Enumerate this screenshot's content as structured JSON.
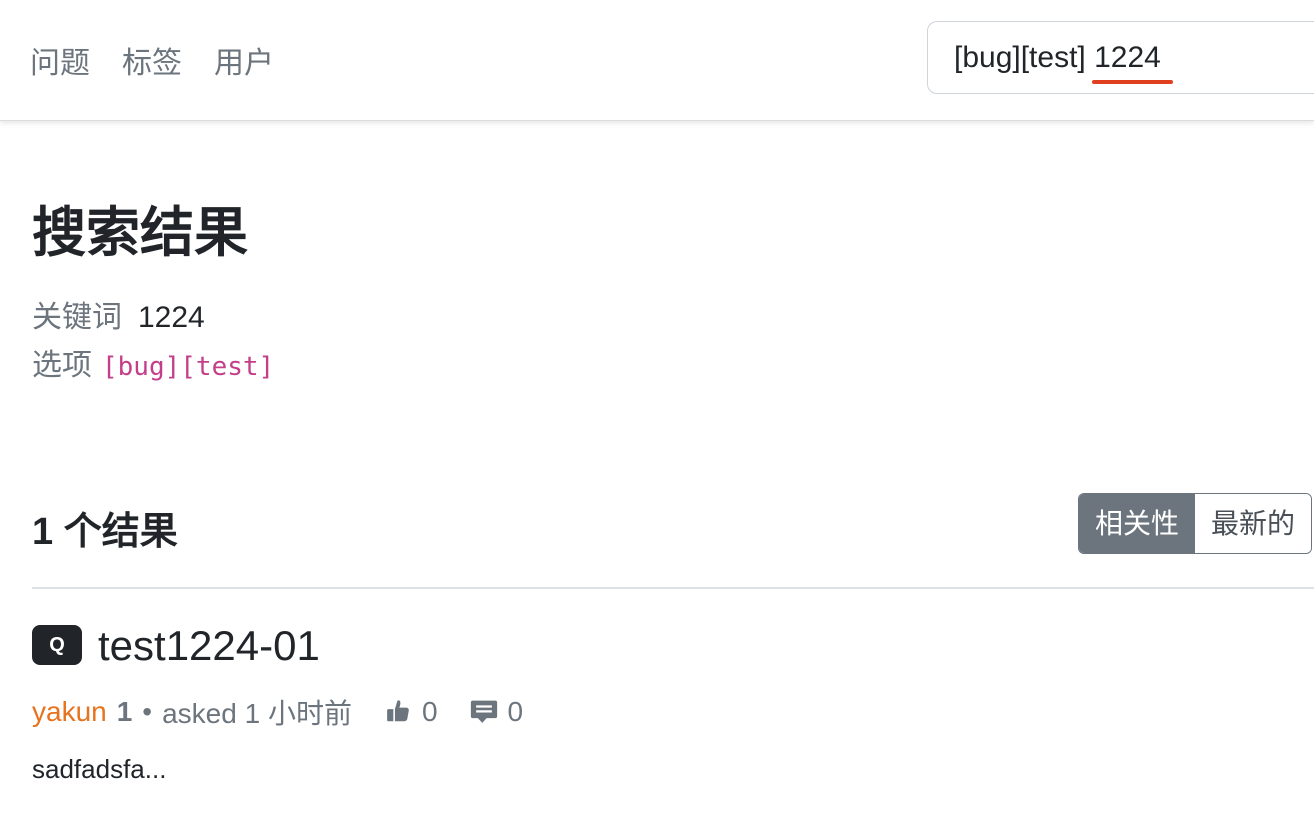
{
  "nav": {
    "questions": "问题",
    "tags": "标签",
    "users": "用户"
  },
  "search": {
    "options_text": "[bug][test]",
    "keyword_text": "1224"
  },
  "page": {
    "title": "搜索结果",
    "keyword_label": "关键词",
    "keyword_value": "1224",
    "options_label": "选项",
    "options_value": "[bug][test]"
  },
  "results": {
    "count_label": "1 个结果",
    "sort": {
      "relevance": "相关性",
      "newest": "最新的"
    },
    "items": [
      {
        "badge": "Q",
        "title": "test1224-01",
        "author": "yakun",
        "reputation": "1",
        "separator": "•",
        "asked": "asked 1 小时前",
        "votes": "0",
        "answers": "0",
        "excerpt": "sadfadsfa..."
      }
    ]
  },
  "colors": {
    "accent_underline": "#e0401f",
    "author": "#e8731e",
    "code": "#c33f8a",
    "active_sort_bg": "#6c757d"
  }
}
